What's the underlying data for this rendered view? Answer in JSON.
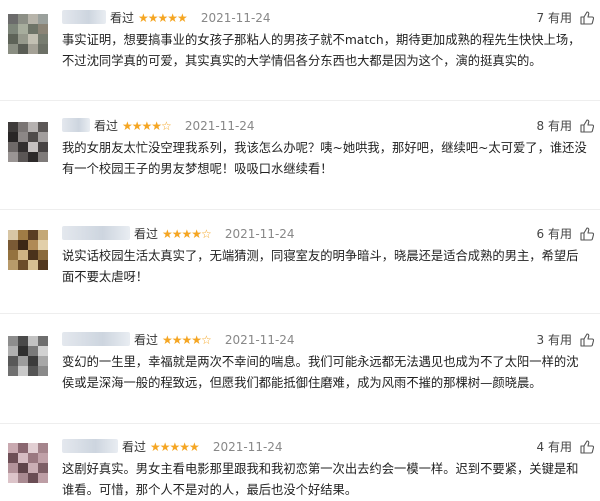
{
  "reviews": [
    {
      "seen_label": "看过",
      "rating": "★★★★★",
      "date": "2021-11-24",
      "useful_count": "7",
      "useful_label": "有用",
      "text": "事实证明，想要搞事业的女孩子那粘人的男孩子就不match，期待更加成熟的程先生快快上场，不过沈同学真的可爱，其实真实的大学情侣各分东西也大都是因为这个，演的挺真实的。"
    },
    {
      "seen_label": "看过",
      "rating": "★★★★☆",
      "date": "2021-11-24",
      "useful_count": "8",
      "useful_label": "有用",
      "text": "我的女朋友太忙没空理我系列，我该怎么办呢？咦~她哄我，那好吧，继续吧~太可爱了，谁还没有一个校园王子的男友梦想呢！吸吸口水继续看！"
    },
    {
      "seen_label": "看过",
      "rating": "★★★★☆",
      "date": "2021-11-24",
      "useful_count": "6",
      "useful_label": "有用",
      "text": "说实话校园生活太真实了，无端猜测，同寝室友的明争暗斗，晓晨还是适合成熟的男主，希望后面不要太虐呀！"
    },
    {
      "seen_label": "看过",
      "rating": "★★★★☆",
      "date": "2021-11-24",
      "useful_count": "3",
      "useful_label": "有用",
      "text": "变幻的一生里，幸福就是两次不幸间的喘息。我们可能永远都无法遇见也成为不了太阳一样的沈侯或是深海一般的程致远，但愿我们都能抵御住磨难，成为风雨不摧的那棵树—颜晓晨。"
    },
    {
      "seen_label": "看过",
      "rating": "★★★★★",
      "date": "2021-11-24",
      "useful_count": "4",
      "useful_label": "有用",
      "text": "这剧好真实。男女主看电影那里跟我和我初恋第一次出去约会一模一样。迟到不要紧，关键是和谁看。可惜，那个人不是对的人，最后也没个好结果。"
    }
  ],
  "colors": {
    "star": "#f5a623",
    "text": "#222222",
    "date": "#888888",
    "username_blur": "#cdd5df"
  }
}
